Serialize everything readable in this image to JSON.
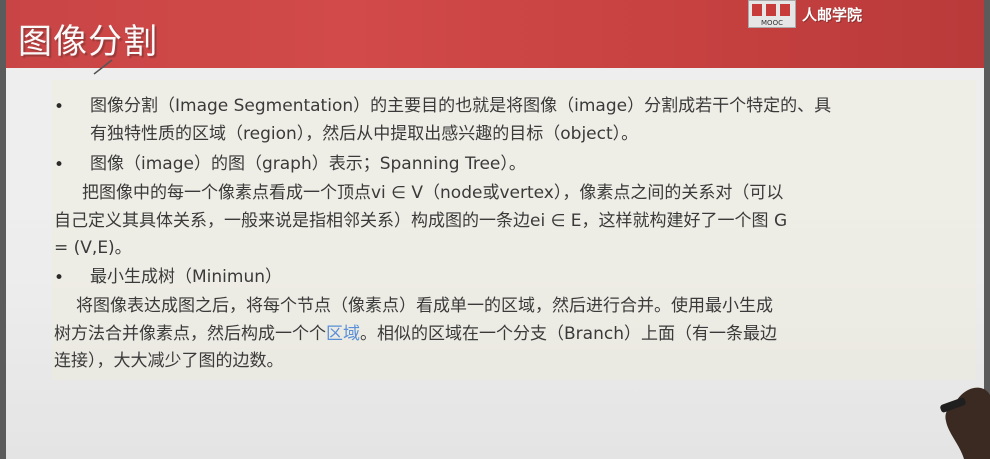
{
  "slide": {
    "title": "图像分割",
    "logo": {
      "text": "人邮学院",
      "mark_text": "MOOC"
    },
    "bullets": [
      {
        "marker": "•",
        "lines": [
          "图像分割（Image Segmentation）的主要目的也就是将图像（image）分割成若干个特定的、具",
          "有独特性质的区域（region），然后从中提取出感兴趣的目标（object）。"
        ]
      },
      {
        "marker": "•",
        "lines": [
          "图像（image）的图（graph）表示；Spanning Tree）。"
        ]
      },
      {
        "marker": "",
        "lines": [
          "把图像中的每一个像素点看成一个顶点vi ∈ V（node或vertex），像素点之间的关系对（可以",
          "自己定义其具体关系，一般来说是指相邻关系）构成图的一条边ei ∈ E，这样就构建好了一个图 G",
          "= (V,E)。"
        ]
      },
      {
        "marker": "•",
        "lines": [
          "最小生成树（Minimun）"
        ]
      },
      {
        "marker": "",
        "lines": [
          "将图像表达成图之后，将每个节点（像素点）看成单一的区域，然后进行合并。使用最小生成",
          "树方法合并像素点，然后构成一个个区域。相似的区域在一个分支（Branch）上面（有一条最边",
          "连接），大大减少了图的边数。"
        ]
      }
    ],
    "highlight_term": "区域",
    "colors": {
      "header": "#cf4747",
      "text": "#3a3a3a",
      "link": "#5a8fd8"
    }
  }
}
